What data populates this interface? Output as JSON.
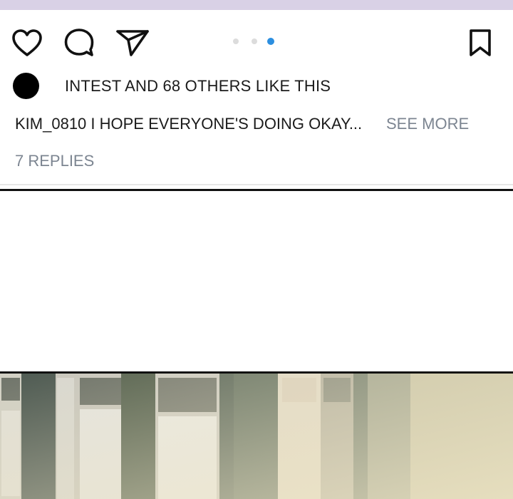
{
  "post": {
    "likes_text": "INTEST AND 68 OTHERS LIKE THIS",
    "caption_text": "KIM_0810 I HOPE EVERYONE'S DOING OKAY...",
    "see_more_label": "SEE MORE",
    "replies_label": "7 REPLIES"
  },
  "carousel": {
    "dot_count": 3,
    "active_index": 2
  },
  "icons": {
    "like": "heart-icon",
    "comment": "comment-bubble-icon",
    "share": "paper-plane-icon",
    "bookmark": "bookmark-icon"
  },
  "colors": {
    "top_band": "#d9d1e6",
    "text": "#1b1b1b",
    "secondary_text": "#7c8591",
    "dot_active": "#2c8fe0",
    "dot_inactive": "#dcdcdc",
    "avatar": "#000000"
  }
}
